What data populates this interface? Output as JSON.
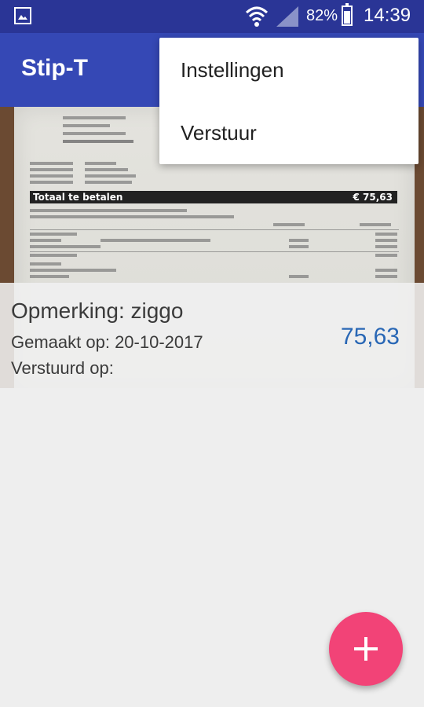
{
  "status_bar": {
    "battery": "82%",
    "time": "14:39",
    "battery_level": 0.82
  },
  "app_bar": {
    "title": "Stip-T"
  },
  "overflow_menu": {
    "items": [
      "Instellingen",
      "Verstuur"
    ]
  },
  "receipt_card": {
    "remark": "Opmerking: ziggo",
    "created": "Gemaakt op: 20-10-2017",
    "sent": "Verstuurd op:",
    "amount": "75,63",
    "image_total_label": "Totaal te betalen",
    "image_total_value": "€ 75,63"
  },
  "fab": {
    "icon": "plus-icon",
    "color": "#f24377"
  },
  "colors": {
    "status_bar": "#2a3596",
    "app_bar": "#3548b5",
    "amount": "#2967b5"
  }
}
